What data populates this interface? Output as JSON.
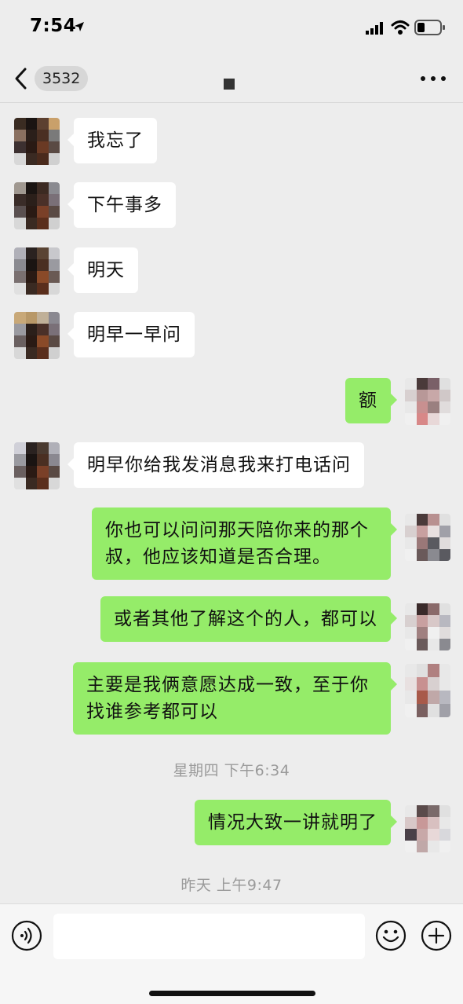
{
  "status_bar": {
    "time": "7:54",
    "icons": [
      "location-arrow-icon",
      "signal-icon",
      "wifi-icon",
      "battery-icon"
    ]
  },
  "nav": {
    "back_badge": "3532",
    "icons": [
      "back-chevron-icon",
      "more-dots-icon"
    ]
  },
  "messages": [
    {
      "side": "left",
      "text": "我忘了"
    },
    {
      "side": "left",
      "text": "下午事多"
    },
    {
      "side": "left",
      "text": "明天"
    },
    {
      "side": "left",
      "text": "明早一早问"
    },
    {
      "side": "right",
      "text": "额"
    },
    {
      "side": "left",
      "text": "明早你给我发消息我来打电话问"
    },
    {
      "side": "right",
      "text": "你也可以问问那天陪你来的那个叔，他应该知道是否合理。"
    },
    {
      "side": "right",
      "text": "或者其他了解这个的人，都可以"
    },
    {
      "side": "right",
      "text": "主要是我俩意愿达成一致，至于你找谁参考都可以"
    },
    {
      "side": "time",
      "text": "星期四 下午6:34"
    },
    {
      "side": "right",
      "text": "情况大致一讲就明了"
    },
    {
      "side": "time",
      "text": "昨天 上午9:47"
    }
  ],
  "input_bar": {
    "input_value": "",
    "icons": [
      "voice-icon",
      "emoji-icon",
      "plus-icon"
    ]
  },
  "colors": {
    "background": "#ededed",
    "bubble_sent": "#95ec69",
    "bubble_received": "#ffffff",
    "timestamp_text": "#9a9a9a"
  }
}
